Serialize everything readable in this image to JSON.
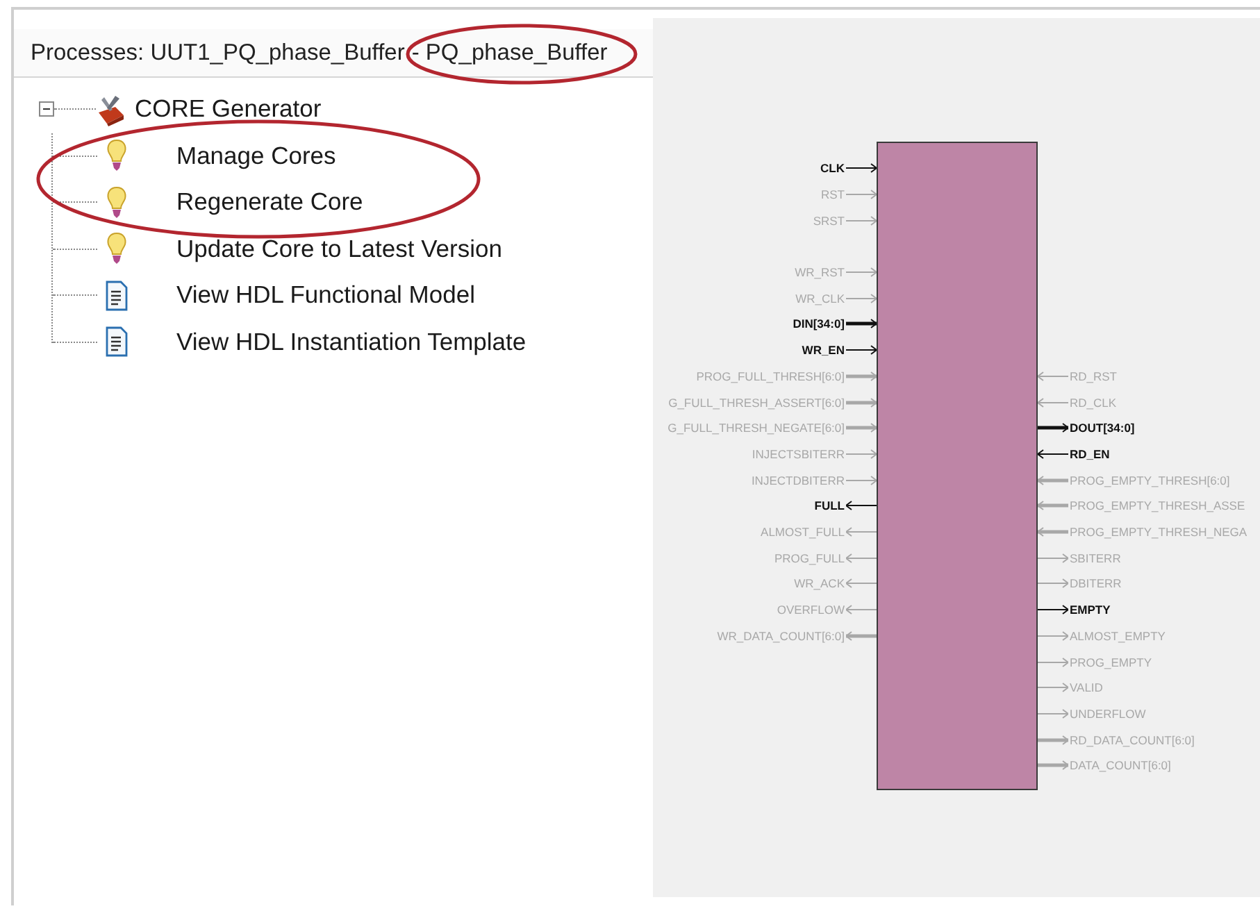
{
  "processes_panel": {
    "title_parts": [
      {
        "text": "Processes: UUT1_PQ_phase_Buffer",
        "circled": false
      },
      {
        "text": "- PQ_phase_Buffer",
        "circled": true
      }
    ],
    "tree": [
      {
        "label": "CORE Generator",
        "kind": "toolbox",
        "expanded": true,
        "children": [
          {
            "label": "Manage Cores",
            "kind": "process",
            "circled": true
          },
          {
            "label": "Regenerate Core",
            "kind": "process",
            "circled": true
          },
          {
            "label": "Update Core to Latest Version",
            "kind": "process",
            "circled": false
          },
          {
            "label": "View HDL Functional Model",
            "kind": "document",
            "circled": false
          },
          {
            "label": "View HDL Instantiation Template",
            "kind": "document",
            "circled": false
          }
        ]
      }
    ]
  },
  "symbol": {
    "left_pin_groups": [
      [
        {
          "name": "CLK",
          "active": true,
          "bus": false,
          "input": true
        },
        {
          "name": "RST",
          "active": false,
          "bus": false,
          "input": true
        },
        {
          "name": "SRST",
          "active": false,
          "bus": false,
          "input": true
        }
      ],
      [
        {
          "name": "WR_RST",
          "active": false,
          "bus": false,
          "input": true
        },
        {
          "name": "WR_CLK",
          "active": false,
          "bus": false,
          "input": true
        },
        {
          "name": "DIN[34:0]",
          "active": true,
          "bus": true,
          "input": true
        },
        {
          "name": "WR_EN",
          "active": true,
          "bus": false,
          "input": true
        },
        {
          "name": "PROG_FULL_THRESH[6:0]",
          "active": false,
          "bus": true,
          "input": true
        },
        {
          "name": "G_FULL_THRESH_ASSERT[6:0]",
          "active": false,
          "bus": true,
          "input": true
        },
        {
          "name": "G_FULL_THRESH_NEGATE[6:0]",
          "active": false,
          "bus": true,
          "input": true
        },
        {
          "name": "INJECTSBITERR",
          "active": false,
          "bus": false,
          "input": true
        },
        {
          "name": "INJECTDBITERR",
          "active": false,
          "bus": false,
          "input": true
        },
        {
          "name": "FULL",
          "active": true,
          "bus": false,
          "input": false
        },
        {
          "name": "ALMOST_FULL",
          "active": false,
          "bus": false,
          "input": false
        },
        {
          "name": "PROG_FULL",
          "active": false,
          "bus": false,
          "input": false
        },
        {
          "name": "WR_ACK",
          "active": false,
          "bus": false,
          "input": false
        },
        {
          "name": "OVERFLOW",
          "active": false,
          "bus": false,
          "input": false
        },
        {
          "name": "WR_DATA_COUNT[6:0]",
          "active": false,
          "bus": true,
          "input": false
        }
      ]
    ],
    "right_pins": [
      {
        "name": "RD_RST",
        "active": false,
        "bus": false,
        "input": true
      },
      {
        "name": "RD_CLK",
        "active": false,
        "bus": false,
        "input": true
      },
      {
        "name": "DOUT[34:0]",
        "active": true,
        "bus": true,
        "input": false
      },
      {
        "name": "RD_EN",
        "active": true,
        "bus": false,
        "input": true
      },
      {
        "name": "PROG_EMPTY_THRESH[6:0]",
        "active": false,
        "bus": true,
        "input": true
      },
      {
        "name": "PROG_EMPTY_THRESH_ASSE",
        "active": false,
        "bus": true,
        "input": true
      },
      {
        "name": "PROG_EMPTY_THRESH_NEGA",
        "active": false,
        "bus": true,
        "input": true
      },
      {
        "name": "SBITERR",
        "active": false,
        "bus": false,
        "input": false
      },
      {
        "name": "DBITERR",
        "active": false,
        "bus": false,
        "input": false
      },
      {
        "name": "EMPTY",
        "active": true,
        "bus": false,
        "input": false
      },
      {
        "name": "ALMOST_EMPTY",
        "active": false,
        "bus": false,
        "input": false
      },
      {
        "name": "PROG_EMPTY",
        "active": false,
        "bus": false,
        "input": false
      },
      {
        "name": "VALID",
        "active": false,
        "bus": false,
        "input": false
      },
      {
        "name": "UNDERFLOW",
        "active": false,
        "bus": false,
        "input": false
      },
      {
        "name": "RD_DATA_COUNT[6:0]",
        "active": false,
        "bus": true,
        "input": false
      },
      {
        "name": "DATA_COUNT[6:0]",
        "active": false,
        "bus": true,
        "input": false
      }
    ]
  }
}
